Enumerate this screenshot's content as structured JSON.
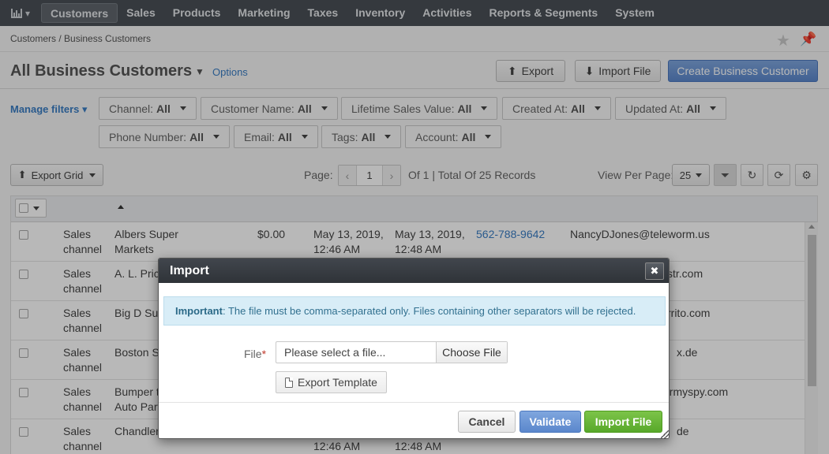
{
  "nav": {
    "items": [
      "Customers",
      "Sales",
      "Products",
      "Marketing",
      "Taxes",
      "Inventory",
      "Activities",
      "Reports & Segments",
      "System"
    ],
    "active": "Customers"
  },
  "breadcrumb": "Customers / Business Customers",
  "header": {
    "title": "All Business Customers",
    "options_label": "Options",
    "export_label": "Export",
    "import_label": "Import File",
    "create_label": "Create Business Customer"
  },
  "filters": {
    "manage_label": "Manage filters",
    "items": [
      {
        "label": "Channel:",
        "value": "All"
      },
      {
        "label": "Customer Name:",
        "value": "All"
      },
      {
        "label": "Lifetime Sales Value:",
        "value": "All"
      },
      {
        "label": "Created At:",
        "value": "All"
      },
      {
        "label": "Updated At:",
        "value": "All"
      },
      {
        "label": "Phone Number:",
        "value": "All"
      },
      {
        "label": "Email:",
        "value": "All"
      },
      {
        "label": "Tags:",
        "value": "All"
      },
      {
        "label": "Account:",
        "value": "All"
      }
    ]
  },
  "grid_toolbar": {
    "export_grid_label": "Export Grid",
    "page_label": "Page:",
    "page_value": "1",
    "records_text": "Of 1 | Total Of 25 Records",
    "view_per_page_label": "View Per Page:",
    "per_page_value": "25"
  },
  "rows": [
    {
      "channel": "Sales\nchannel",
      "name": "Albers Super\nMarkets",
      "sales": "$0.00",
      "created": "May 13, 2019,\n12:46 AM",
      "updated": "May 13, 2019,\n12:48 AM",
      "phone": "562-788-9642",
      "email": "NancyDJones@teleworm.us"
    },
    {
      "channel": "Sales\nchannel",
      "name": "A. L. Pric",
      "sales": "",
      "created": "",
      "updated": "",
      "phone": "",
      "email": "str.com"
    },
    {
      "channel": "Sales\nchannel",
      "name": "Big D Sup",
      "sales": "",
      "created": "",
      "updated": "",
      "phone": "",
      "email": "rrito.com"
    },
    {
      "channel": "Sales\nchannel",
      "name": "Boston S",
      "sales": "",
      "created": "",
      "updated": "",
      "phone": "",
      "email": "x.de"
    },
    {
      "channel": "Sales\nchannel",
      "name": "Bumper t\nAuto Part",
      "sales": "",
      "created": "",
      "updated": "",
      "phone": "",
      "email": "armyspy.com"
    },
    {
      "channel": "Sales\nchannel",
      "name": "Chandler'",
      "sales": "",
      "created": "\n12:46 AM",
      "updated": "\n12:48 AM",
      "phone": "",
      "email": "de"
    }
  ],
  "modal": {
    "title": "Import",
    "alert_strong": "Important",
    "alert_text": ": The file must be comma-separated only. Files containing other separators will be rejected.",
    "file_label": "File",
    "required_mark": "*",
    "file_placeholder": "Please select a file...",
    "choose_file_label": "Choose File",
    "export_template_label": "Export Template",
    "cancel_label": "Cancel",
    "validate_label": "Validate",
    "import_label": "Import File"
  }
}
